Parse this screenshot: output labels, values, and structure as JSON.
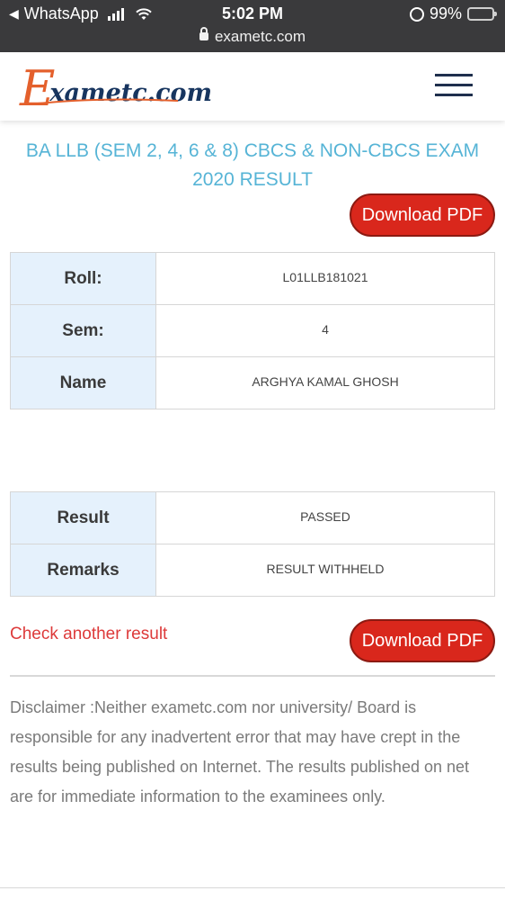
{
  "status_bar": {
    "back_app": "WhatsApp",
    "time": "5:02 PM",
    "battery": "99%",
    "battery_level": 0.99,
    "url": "exametc.com"
  },
  "header": {
    "logo_initial": "E",
    "logo_rest": "xametc.com",
    "logo_colors": {
      "initial": "#e4602c",
      "rest": "#17355f"
    }
  },
  "page": {
    "title": "BA LLB (SEM 2, 4, 6 & 8) CBCS & NON-CBCS EXAM 2020 RESULT",
    "download_label": "Download PDF",
    "details": [
      {
        "label": "Roll:",
        "value": "L01LLB181021"
      },
      {
        "label": "Sem:",
        "value": "4"
      },
      {
        "label": "Name",
        "value": "ARGHYA KAMAL GHOSH"
      }
    ],
    "results": [
      {
        "label": "Result",
        "value": "PASSED"
      },
      {
        "label": "Remarks",
        "value": "RESULT WITHHELD"
      }
    ],
    "check_another": "Check another result",
    "disclaimer": "Disclaimer :Neither exametc.com nor university/ Board is responsible for any inadvertent error that may have crept in the results being published on Internet. The results published on net are for immediate information to the examinees only."
  },
  "colors": {
    "title": "#56b4d6",
    "button": "#d9271c",
    "link": "#dd3a3a",
    "label_cell": "#e5f1fc",
    "status_bar": "#3a3a3c"
  },
  "icons": [
    "back-arrow-icon",
    "signal-icon",
    "wifi-icon",
    "rotation-lock-icon",
    "battery-icon",
    "lock-icon",
    "hamburger-menu-icon"
  ]
}
